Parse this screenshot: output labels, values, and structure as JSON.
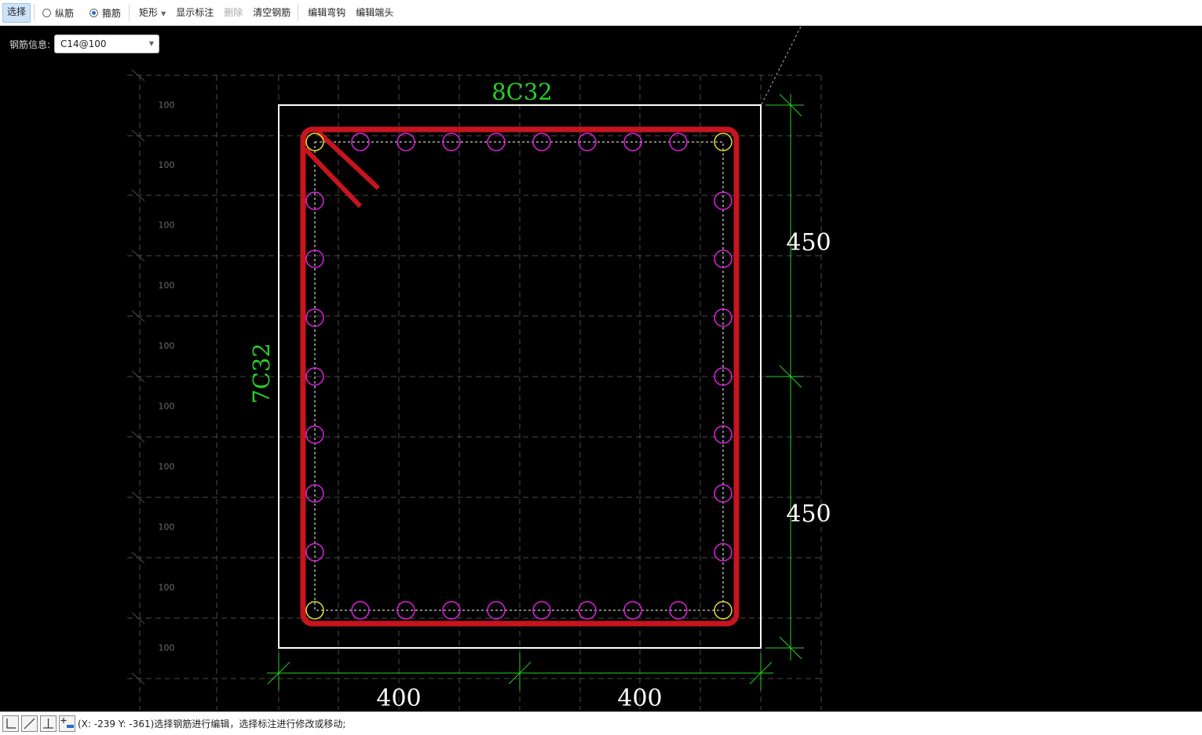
{
  "toolbar": {
    "select": "选择",
    "longitudinal": "纵筋",
    "stirrup": "箍筋",
    "shape": "矩形",
    "show_dim": "显示标注",
    "delete": "删除",
    "clear": "清空钢筋",
    "edit_hook": "编辑弯钩",
    "edit_end": "编辑端头"
  },
  "rebar_info": {
    "label": "钢筋信息:",
    "value": "C14@100"
  },
  "drawing": {
    "top_label": "8C32",
    "side_label": "7C32",
    "dims_right": [
      "450",
      "450"
    ],
    "dims_bottom": [
      "400",
      "400"
    ],
    "grid_labels": [
      "100",
      "100",
      "100",
      "100",
      "100",
      "100",
      "100",
      "100",
      "100",
      "100"
    ],
    "colors": {
      "stirrup": "#c8141e",
      "bar": "#e020e0",
      "corner_bar": "#e8e030",
      "dim": "#28d028",
      "outline": "#ffffff"
    }
  },
  "status": {
    "text": "(X: -239 Y: -361)选择钢筋进行编辑，选择标注进行修改或移动;"
  }
}
